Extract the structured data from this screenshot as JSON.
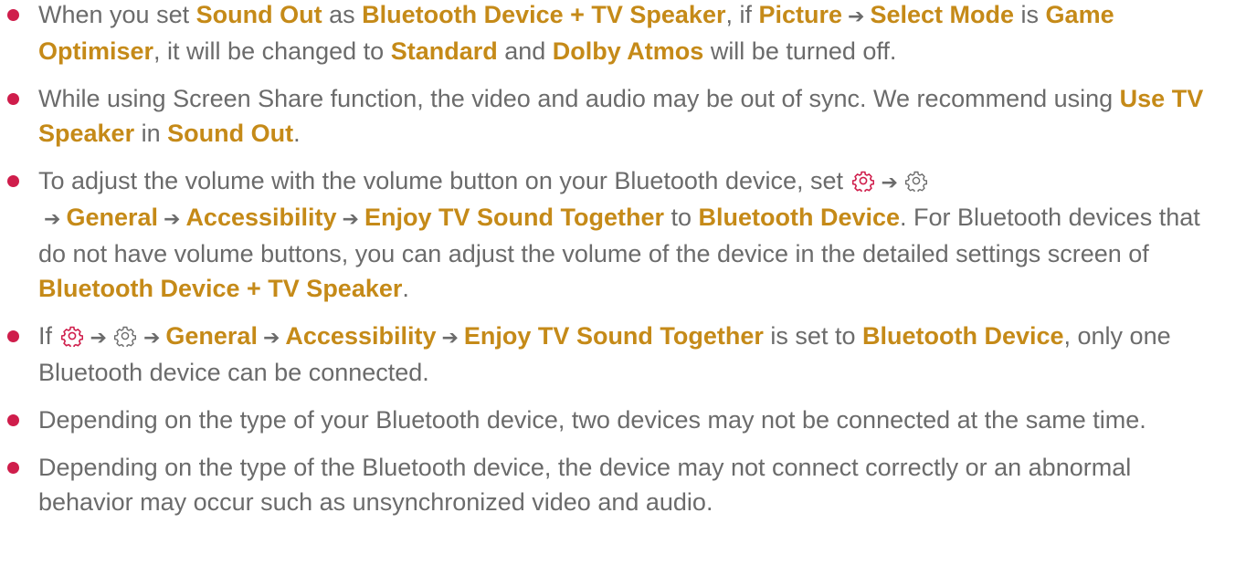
{
  "arrow": "➔",
  "colors": {
    "bullet": "#cf1d4b",
    "highlight": "#c58a18",
    "text": "#6b6b6b"
  },
  "icons": [
    "settings-red-icon",
    "settings-gray-icon"
  ],
  "items": [
    {
      "t1": "When you set ",
      "b1": "Sound Out",
      "t2": " as ",
      "b2": "Bluetooth Device + TV Speaker",
      "t3": ", if ",
      "b3": "Picture",
      "b4": "Select Mode",
      "t4": " is ",
      "b5": "Game Optimiser",
      "t5": ", it will be changed to ",
      "b6": "Standard",
      "t6": " and ",
      "b7": "Dolby Atmos",
      "t7": " will be turned off."
    },
    {
      "t1": "While using Screen Share function, the video and audio may be out of sync. We recommend using ",
      "b1": "Use TV Speaker",
      "t2": " in ",
      "b2": "Sound Out",
      "t3": "."
    },
    {
      "t1": "To adjust the volume with the volume button on your Bluetooth device, set ",
      "b1": "General",
      "b2": "Accessibility",
      "b3": "Enjoy TV Sound Together",
      "t2": " to ",
      "b4": "Bluetooth Device",
      "t3": ". For Bluetooth devices that do not have volume buttons, you can adjust the volume of the device in the detailed settings screen of ",
      "b5": "Bluetooth Device + TV Speaker",
      "t4": "."
    },
    {
      "t1": "If ",
      "b1": "General",
      "b2": "Accessibility",
      "b3": "Enjoy TV Sound Together",
      "t2": " is set to ",
      "b4": "Bluetooth Device",
      "t3": ", only one Bluetooth device can be connected."
    },
    {
      "t1": "Depending on the type of your Bluetooth device, two devices may not be connected at the same time."
    },
    {
      "t1": "Depending on the type of the Bluetooth device, the device may not connect correctly or an abnormal behavior may occur such as unsynchronized video and audio."
    }
  ]
}
